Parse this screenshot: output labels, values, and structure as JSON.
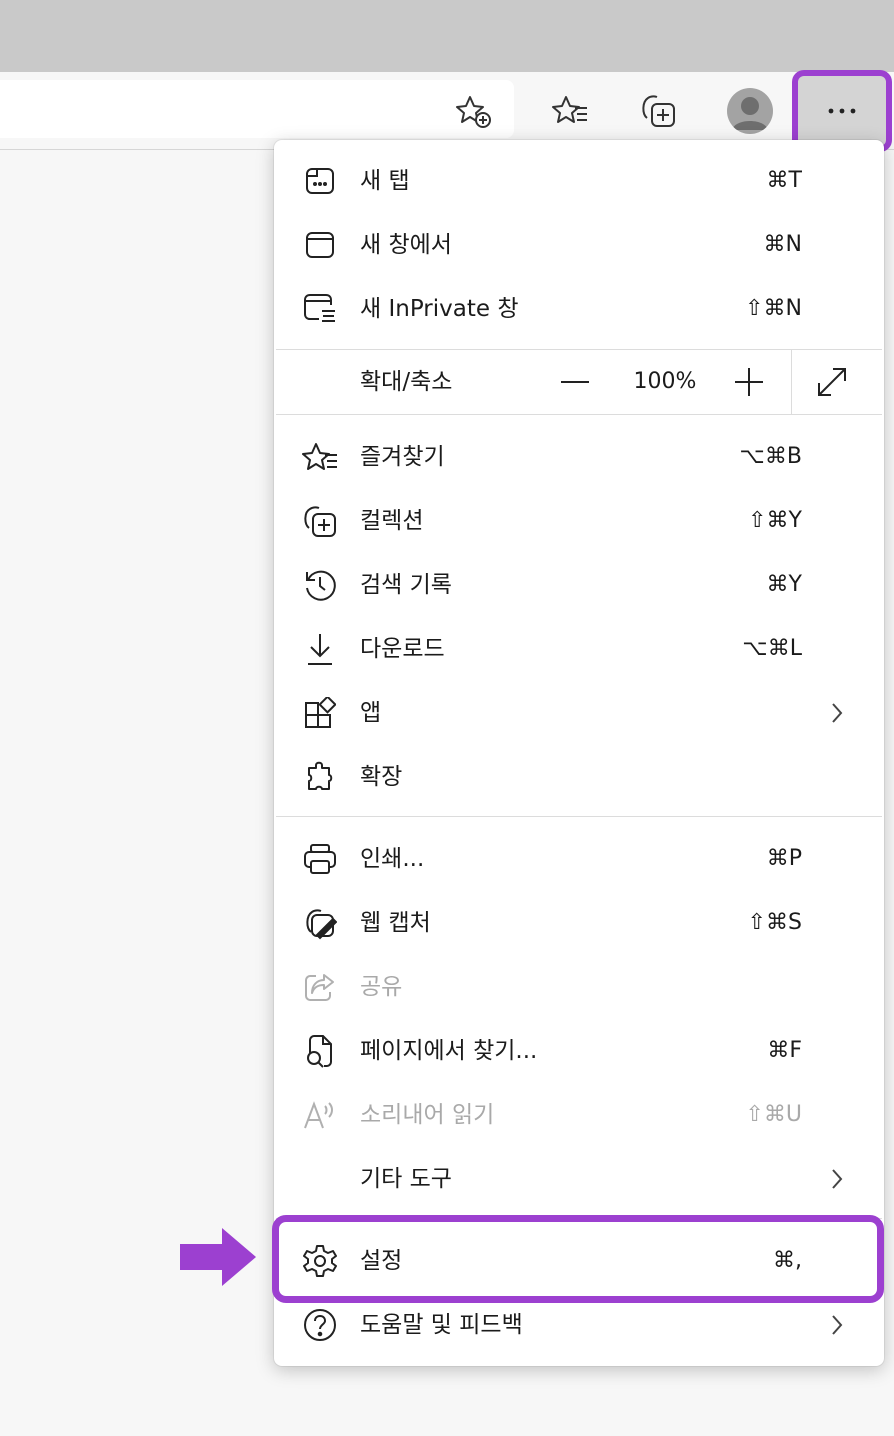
{
  "browser": {
    "toolbar": {
      "favorite_star_icon": "star-add-icon",
      "favorites_icon": "favorites-icon",
      "collections_icon": "collections-icon",
      "profile_icon": "avatar-icon",
      "more_button_icon": "ellipsis-icon"
    },
    "colors": {
      "highlight": "#9c40d0",
      "disabled_text": "#a9a9a9",
      "text": "#1b1b1b"
    }
  },
  "menu": {
    "group1": [
      {
        "label": "새 탭",
        "shortcut": "⌘T",
        "icon": "new-tab-icon"
      },
      {
        "label": "새 창에서",
        "shortcut": "⌘N",
        "icon": "new-window-icon"
      },
      {
        "label": "새 InPrivate 창",
        "shortcut": "⇧⌘N",
        "icon": "inprivate-window-icon"
      }
    ],
    "zoom": {
      "label": "확대/축소",
      "value": "100%",
      "minus_icon": "minus-icon",
      "plus_icon": "plus-icon",
      "fullscreen_icon": "fullscreen-icon"
    },
    "group2": [
      {
        "label": "즐겨찾기",
        "shortcut": "⌥⌘B",
        "icon": "favorites-icon"
      },
      {
        "label": "컬렉션",
        "shortcut": "⇧⌘Y",
        "icon": "collections-icon"
      },
      {
        "label": "검색 기록",
        "shortcut": "⌘Y",
        "icon": "history-icon"
      },
      {
        "label": "다운로드",
        "shortcut": "⌥⌘L",
        "icon": "download-icon"
      },
      {
        "label": "앱",
        "shortcut": "",
        "icon": "apps-icon",
        "submenu": true
      },
      {
        "label": "확장",
        "shortcut": "",
        "icon": "extensions-icon"
      }
    ],
    "group3": [
      {
        "label": "인쇄...",
        "shortcut": "⌘P",
        "icon": "print-icon"
      },
      {
        "label": "웹 캡처",
        "shortcut": "⇧⌘S",
        "icon": "web-capture-icon"
      },
      {
        "label": "공유",
        "shortcut": "",
        "icon": "share-icon",
        "disabled": true
      },
      {
        "label": "페이지에서 찾기...",
        "shortcut": "⌘F",
        "icon": "find-in-page-icon"
      },
      {
        "label": "소리내어 읽기",
        "shortcut": "⇧⌘U",
        "icon": "read-aloud-icon",
        "disabled": true
      },
      {
        "label": "기타 도구",
        "shortcut": "",
        "icon": "",
        "submenu": true
      }
    ],
    "group4": [
      {
        "label": "설정",
        "shortcut": "⌘,",
        "icon": "gear-icon",
        "highlighted": true
      },
      {
        "label": "도움말 및 피드백",
        "shortcut": "",
        "icon": "help-icon",
        "submenu": true
      }
    ]
  },
  "annotation": {
    "arrow_icon": "right-arrow-icon"
  }
}
